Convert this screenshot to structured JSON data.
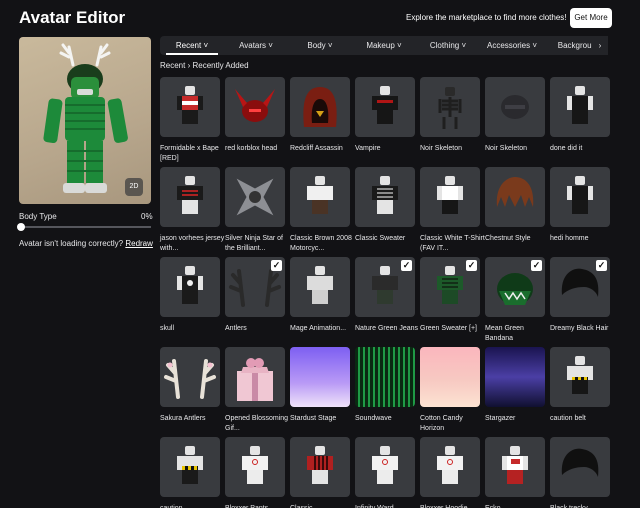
{
  "header": {
    "title": "Avatar Editor",
    "promo_text": "Explore the marketplace to find more clothes!",
    "get_more_label": "Get More"
  },
  "avatar": {
    "view_toggle": "2D",
    "body_type_label": "Body Type",
    "body_type_value": "0%",
    "help_text": "Avatar isn't loading correctly?",
    "redraw_label": "Redraw"
  },
  "tabs": [
    {
      "label": "Recent ˅"
    },
    {
      "label": "Avatars ˅"
    },
    {
      "label": "Body ˅"
    },
    {
      "label": "Makeup ˅"
    },
    {
      "label": "Clothing ˅"
    },
    {
      "label": "Accessories ˅"
    },
    {
      "label": "Backgrour"
    }
  ],
  "tabs_next": "›",
  "breadcrumb": {
    "root": "Recent",
    "separator": "›",
    "current": "Recently Added"
  },
  "items": [
    {
      "name": "Formidable x Bape [RED]",
      "thumb": "fig-red",
      "equipped": false
    },
    {
      "name": "red korblox head",
      "thumb": "korblox",
      "equipped": false
    },
    {
      "name": "Redcliff Assassin",
      "thumb": "hood",
      "equipped": false
    },
    {
      "name": "Vampire",
      "thumb": "vampire",
      "equipped": false
    },
    {
      "name": "Noir Skeleton",
      "thumb": "skeleton",
      "equipped": false
    },
    {
      "name": "Noir Skeleton",
      "thumb": "skull-dark",
      "equipped": false
    },
    {
      "name": "done did it",
      "thumb": "fig-black",
      "equipped": false
    },
    {
      "name": "jason vorhees jersey with...",
      "thumb": "fig-stripe",
      "equipped": false
    },
    {
      "name": "Silver Ninja Star of the Brilliant...",
      "thumb": "star",
      "equipped": false
    },
    {
      "name": "Classic Brown 2008 Motorcyc...",
      "thumb": "fig-brown",
      "equipped": false
    },
    {
      "name": "Classic Sweater",
      "thumb": "fig-sweater",
      "equipped": false
    },
    {
      "name": "Classic White T-Shirt (FAV IT...",
      "thumb": "fig-white",
      "equipped": false
    },
    {
      "name": "Chestnut Style",
      "thumb": "hair-brown",
      "equipped": false
    },
    {
      "name": "hedi homme",
      "thumb": "fig-black",
      "equipped": false
    },
    {
      "name": "skull",
      "thumb": "fig-skull",
      "equipped": false
    },
    {
      "name": "Antlers",
      "thumb": "antlers-dark",
      "equipped": true
    },
    {
      "name": "Mage Animation...",
      "thumb": "fig-pose",
      "equipped": false
    },
    {
      "name": "Nature Green Jeans",
      "thumb": "fig-dark",
      "equipped": true
    },
    {
      "name": "Green Sweater [+]",
      "thumb": "fig-green",
      "equipped": true
    },
    {
      "name": "Mean Green Bandana",
      "thumb": "bandana",
      "equipped": true
    },
    {
      "name": "Dreamy Black Hair",
      "thumb": "hair-black",
      "equipped": true
    },
    {
      "name": "Sakura Antlers",
      "thumb": "antlers-light",
      "equipped": false
    },
    {
      "name": "Opened Blossoming Gif...",
      "thumb": "gift",
      "equipped": false
    },
    {
      "name": "Stardust Stage",
      "thumb": "bg-purple",
      "equipped": false
    },
    {
      "name": "Soundwave",
      "thumb": "bg-green",
      "equipped": false
    },
    {
      "name": "Cotton Candy Horizon",
      "thumb": "bg-pink",
      "equipped": false
    },
    {
      "name": "Stargazer",
      "thumb": "bg-night",
      "equipped": false
    },
    {
      "name": "caution belt",
      "thumb": "fig-belt",
      "equipped": false
    },
    {
      "name": "caution",
      "thumb": "fig-caution",
      "equipped": false
    },
    {
      "name": "Bloxxer Pants",
      "thumb": "fig-bloxxer",
      "equipped": false
    },
    {
      "name": "Classic",
      "thumb": "fig-plaid",
      "equipped": false
    },
    {
      "name": "Infinity Ward",
      "thumb": "fig-bloxxer",
      "equipped": false
    },
    {
      "name": "Bloxxer Hoodie",
      "thumb": "fig-bloxxer",
      "equipped": false
    },
    {
      "name": "Ecko",
      "thumb": "fig-ecko",
      "equipped": false
    },
    {
      "name": "Black trecky",
      "thumb": "hair-black",
      "equipped": false
    }
  ],
  "colors": {
    "background": "#121215",
    "tile": "#393b3f",
    "tabbar": "#232428",
    "sweater_green": "#1d8a3a"
  }
}
